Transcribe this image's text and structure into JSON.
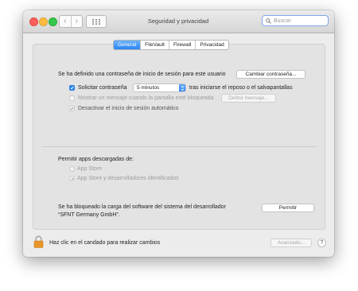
{
  "window": {
    "title": "Seguridad y privacidad"
  },
  "toolbar": {
    "back_glyph": "‹",
    "forward_glyph": "›",
    "grid_icon": "grid-icon"
  },
  "search": {
    "placeholder": "Buscar",
    "icon": "search-icon"
  },
  "tabs": [
    {
      "label": "General",
      "active": true
    },
    {
      "label": "FileVault",
      "active": false
    },
    {
      "label": "Firewall",
      "active": false
    },
    {
      "label": "Privacidad",
      "active": false
    }
  ],
  "general": {
    "password_notice": "Se ha definido una contraseña de inicio de sesión para este usuario",
    "change_password_button": "Cambiar contraseña...",
    "require_password": {
      "label": "Solicitar contraseña",
      "checked": true,
      "selected_option": "5 minutos",
      "suffix": "tras iniciarse el reposo o el salvapantallas"
    },
    "show_message": {
      "label": "Mostrar un mensaje cuando la pantalla esté bloqueada",
      "checked": false,
      "button": "Definir mensaje..."
    },
    "disable_auto_login": {
      "label": "Desactivar el inicio de sesión automático",
      "checked": true
    },
    "downloads_heading": "Permitir apps descargadas de:",
    "downloads_options": [
      {
        "label": "App Store",
        "selected": false
      },
      {
        "label": "App Store y desarrolladores identificados",
        "selected": true
      }
    ],
    "blocked_notice": "Se ha bloqueado la carga del software del sistema del desarrollador “SFNT Germany GmbH”.",
    "allow_button": "Permitir"
  },
  "footer": {
    "lock_text": "Haz clic en el candado para realizar cambios",
    "advanced_button": "Avanzado...",
    "help": "?",
    "lock_icon": "lock-icon"
  },
  "colors": {
    "accent": "#2e86f5",
    "lock": "#e8962a"
  }
}
